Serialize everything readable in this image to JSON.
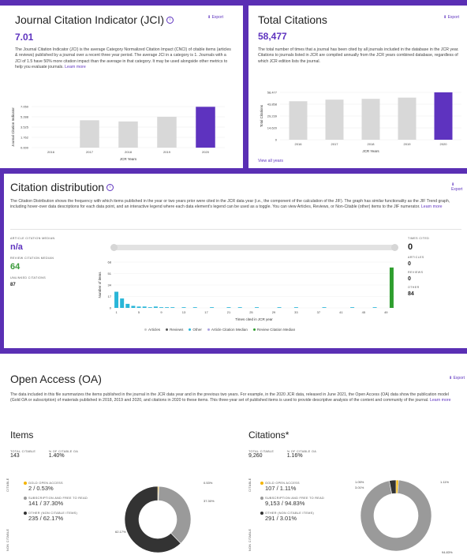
{
  "jci": {
    "title": "Journal Citation Indicator (JCI)",
    "export": "Export",
    "value": "7.01",
    "description": "The Journal Citation Indicator (JCI) is the average Category Normalized Citation Impact (CNCI) of citable items (articles & reviews) published by a journal over a recent three year period. The average JCI in a category is 1. Journals with a JCI of 1.5 have 50% more citation impact than the average in that category. It may be used alongside other metrics to help you evaluate journals.",
    "learn_more": "Learn more",
    "chart_data": {
      "type": "bar",
      "categories": [
        "2016",
        "2017",
        "2018",
        "2019",
        "2020"
      ],
      "values": [
        0,
        4.7,
        4.5,
        5.3,
        7.01
      ],
      "ylabel": "Journal Citation Indicator",
      "xlabel": "JCR Years",
      "yticks": [
        "0.000",
        "1.762",
        "3.525",
        "5.288",
        "7.050"
      ],
      "ylim": [
        0,
        7.05
      ]
    }
  },
  "total_citations": {
    "title": "Total Citations",
    "export": "Export",
    "value": "58,477",
    "description": "The total number of times that a journal has been cited by all journals included in the database in the JCR year. Citations to journals listed in JCR are compiled annually from the JCR years combined database, regardless of which JCR edition lists the journal.",
    "view_all": "View all years",
    "chart_data": {
      "type": "bar",
      "categories": [
        "2016",
        "2017",
        "2018",
        "2019",
        "2020"
      ],
      "values": [
        47500,
        49500,
        50500,
        52000,
        58477
      ],
      "ylabel": "Total Citations",
      "xlabel": "JCR Years",
      "yticks": [
        "0",
        "14,620",
        "29,239",
        "43,858",
        "58,477"
      ],
      "ylim": [
        0,
        58477
      ]
    }
  },
  "citation_distribution": {
    "title": "Citation distribution",
    "export": "Export",
    "description": "The Citation Distribution shows the frequency with which items published in the year or two years prior were cited in the JCR data year (i.e., the component of the calculation of the JIF). The graph has similar functionality as the JIF Trend graph, including hover-over data descriptions for each data point, and an interactive legend where each data element's legend can be used as a toggle. You can view Articles, Reviews, or Non-Citable (other) items to the JIF numerator.",
    "learn_more": "Learn more",
    "left_metrics": [
      {
        "label": "ARTICLE CITATION MEDIAN",
        "value": "n/a",
        "color": "#5e33bf"
      },
      {
        "label": "REVIEW CITATION MEDIAN",
        "value": "64",
        "color": "#3a9a3a"
      },
      {
        "label": "UNLINKED CITATIONS",
        "value": "87",
        "color": "#222"
      }
    ],
    "right_metrics": [
      {
        "label": "TIMES CITED",
        "value": "0"
      },
      {
        "label": "ARTICLES",
        "value": "0"
      },
      {
        "label": "REVIEWS",
        "value": "0"
      },
      {
        "label": "OTHER",
        "value": "84"
      }
    ],
    "chart_data": {
      "type": "bar",
      "xlabel": "Times cited in JCR year",
      "ylabel": "Number of items",
      "yticks": [
        "0",
        "17",
        "34",
        "51",
        "68"
      ],
      "ylim": [
        0,
        68
      ],
      "xticks": [
        "1",
        "5",
        "9",
        "13",
        "17",
        "21",
        "25",
        "29",
        "33",
        "37",
        "41",
        "45",
        "49"
      ],
      "other_values": [
        24,
        14,
        6,
        3,
        2,
        2,
        1,
        2,
        1,
        1,
        1,
        0,
        1,
        0,
        1,
        0,
        0,
        1,
        0,
        0,
        1,
        0,
        1,
        0,
        0,
        1,
        0,
        0,
        0,
        1,
        0,
        0,
        1,
        0,
        0,
        0,
        0,
        1,
        0,
        0,
        0,
        0,
        1,
        0,
        0,
        0,
        1,
        0,
        0,
        1
      ],
      "review_values": [
        0,
        0,
        0,
        0,
        0,
        0,
        0,
        0,
        0,
        0,
        0,
        0,
        0,
        0,
        0,
        0,
        0,
        0,
        0,
        0,
        0,
        0,
        0,
        0,
        0,
        0,
        0,
        0,
        0,
        0,
        0,
        0,
        0,
        0,
        0,
        0,
        0,
        0,
        0,
        0,
        0,
        0,
        0,
        0,
        0,
        0,
        0,
        0,
        0,
        60
      ],
      "legend": [
        "Articles",
        "Reviews",
        "Other",
        "Article Citation Median",
        "Review Citation Median"
      ],
      "legend_colors": [
        "#c8c8c8",
        "#555555",
        "#29b6d8",
        "#aaa0e0",
        "#2e9e2e"
      ]
    }
  },
  "open_access": {
    "title": "Open Access (OA)",
    "export": "Export",
    "description": "The data included in this file summarizes the items published in the journal in the JCR data year and in the previous two years. For example, in the 2020 JCR data, released in June 2021, the Open Access (OA) data show the publication model (Gold OA or subscription) of materials published in 2018, 2019 and 2020, and citations in 2020 to these items. This three-year set of published items is used to provide descriptive analysis of the content and community of the journal.",
    "learn_more": "Learn more",
    "items": {
      "heading": "Items",
      "total_label": "TOTAL CITABLE",
      "total_value": "143",
      "pct_label": "% OF CITABLE OA",
      "pct_value": "1.40%",
      "side_label_top": "CITABLE",
      "side_label_bottom": "NON CITABLE",
      "rows": [
        {
          "label": "GOLD OPEN ACCESS",
          "value": "2 / 0.53%",
          "color": "#f4b400"
        },
        {
          "label": "SUBSCRIPTION AND FREE TO READ",
          "value": "141 / 37.30%",
          "color": "#9a9a9a"
        },
        {
          "label": "OTHER (NON CITABLE ITEMS)",
          "value": "235 / 62.17%",
          "color": "#333333"
        }
      ],
      "chart_data": {
        "type": "pie",
        "labels": [
          "Gold Open Access",
          "Subscription and Free to Read",
          "Other (non citable items)"
        ],
        "values": [
          0.53,
          37.3,
          62.17
        ],
        "data_labels": [
          "0.53%",
          "37.30%",
          "62.17%"
        ],
        "colors": [
          "#f4b400",
          "#9a9a9a",
          "#333333"
        ]
      }
    },
    "citations": {
      "heading": "Citations*",
      "total_label": "TOTAL CITABLE",
      "total_value": "9,260",
      "pct_label": "% OF CITABLE OA",
      "pct_value": "1.16%",
      "side_label_top": "CITABLE",
      "side_label_bottom": "NON CITABLE",
      "rows": [
        {
          "label": "GOLD OPEN ACCESS",
          "value": "107 / 1.11%",
          "color": "#f4b400"
        },
        {
          "label": "SUBSCRIPTION AND FREE TO READ",
          "value": "9,153 / 94.83%",
          "color": "#9a9a9a"
        },
        {
          "label": "OTHER (NON CITABLE ITEMS)",
          "value": "291 / 3.01%",
          "color": "#333333"
        }
      ],
      "chart_data": {
        "type": "pie",
        "labels": [
          "Gold Open Access",
          "Subscription and Free to Read",
          "Other (non citable items)"
        ],
        "values": [
          1.11,
          94.83,
          3.01
        ],
        "data_labels": [
          "1.11%",
          "94.83%",
          "3.01%"
        ],
        "extra_label": "1.05%",
        "colors": [
          "#f4b400",
          "#9a9a9a",
          "#333333"
        ]
      }
    }
  }
}
